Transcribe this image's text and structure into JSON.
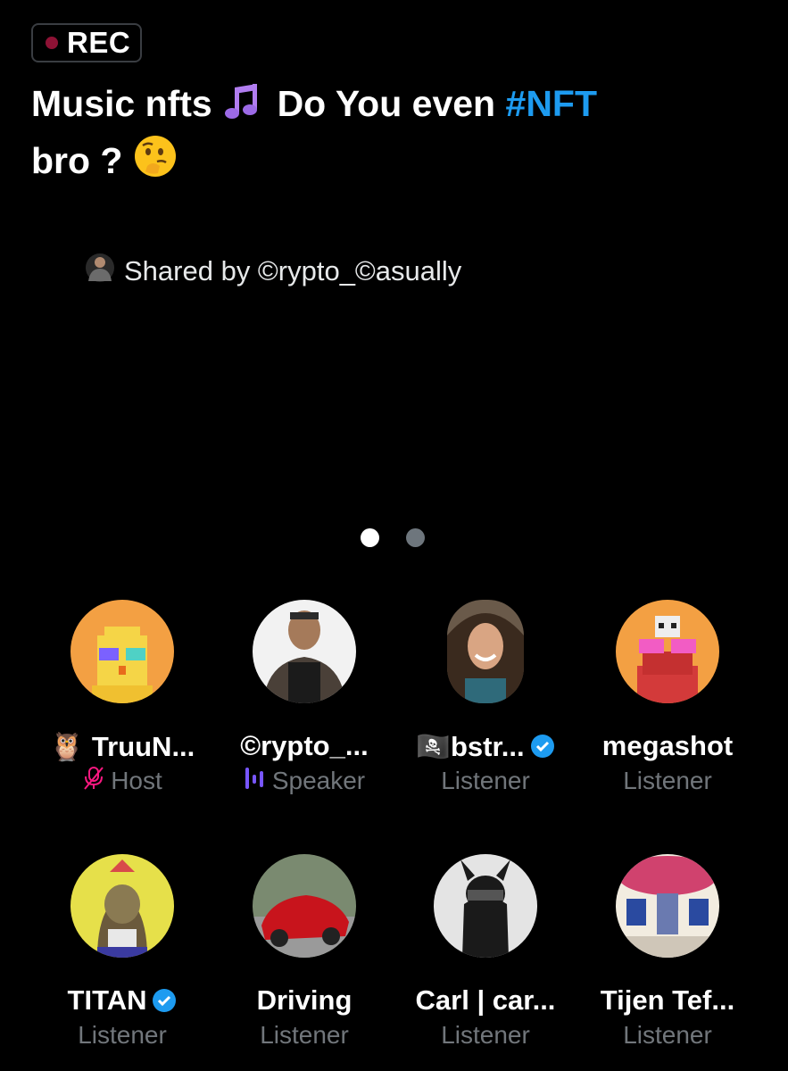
{
  "rec": {
    "label": "REC",
    "dot_color": "#8e1235"
  },
  "space": {
    "title_part1": "Music nfts",
    "title_part2": "Do You even",
    "title_hashtag": "#NFT",
    "title_part3": "bro ?",
    "title_emoji_1": "music-notes",
    "title_emoji_2": "thinking-face"
  },
  "shared": {
    "text": "Shared by ©rypto_©asually"
  },
  "pager": {
    "count": 2,
    "active_index": 0
  },
  "colors": {
    "accent": "#1d9bf0",
    "muted": "#71767b",
    "mic_off": "#f4212e",
    "speaker": "#7856ff"
  },
  "participants": [
    {
      "name": "🦉 TruuN...",
      "role": "Host",
      "role_icon": "mic-off-icon",
      "verified": false,
      "avatar": "owl-pixel"
    },
    {
      "name": "©rypto_...",
      "role": "Speaker",
      "role_icon": "speaking-bars-icon",
      "verified": false,
      "avatar": "tattooed-man"
    },
    {
      "name": "🏴‍☠️bstr...",
      "role": "Listener",
      "verified": true,
      "avatar": "smiling-woman"
    },
    {
      "name": "megashot",
      "role": "Listener",
      "verified": false,
      "avatar": "pixel-skull"
    },
    {
      "name": "TITAN",
      "role": "Listener",
      "verified": true,
      "avatar": "ape-yellow"
    },
    {
      "name": "Driving",
      "role": "Listener",
      "verified": false,
      "avatar": "red-car"
    },
    {
      "name": "Carl | car...",
      "role": "Listener",
      "verified": false,
      "avatar": "black-character"
    },
    {
      "name": "Tijen Tef...",
      "role": "Listener",
      "verified": false,
      "avatar": "flower-house"
    }
  ]
}
